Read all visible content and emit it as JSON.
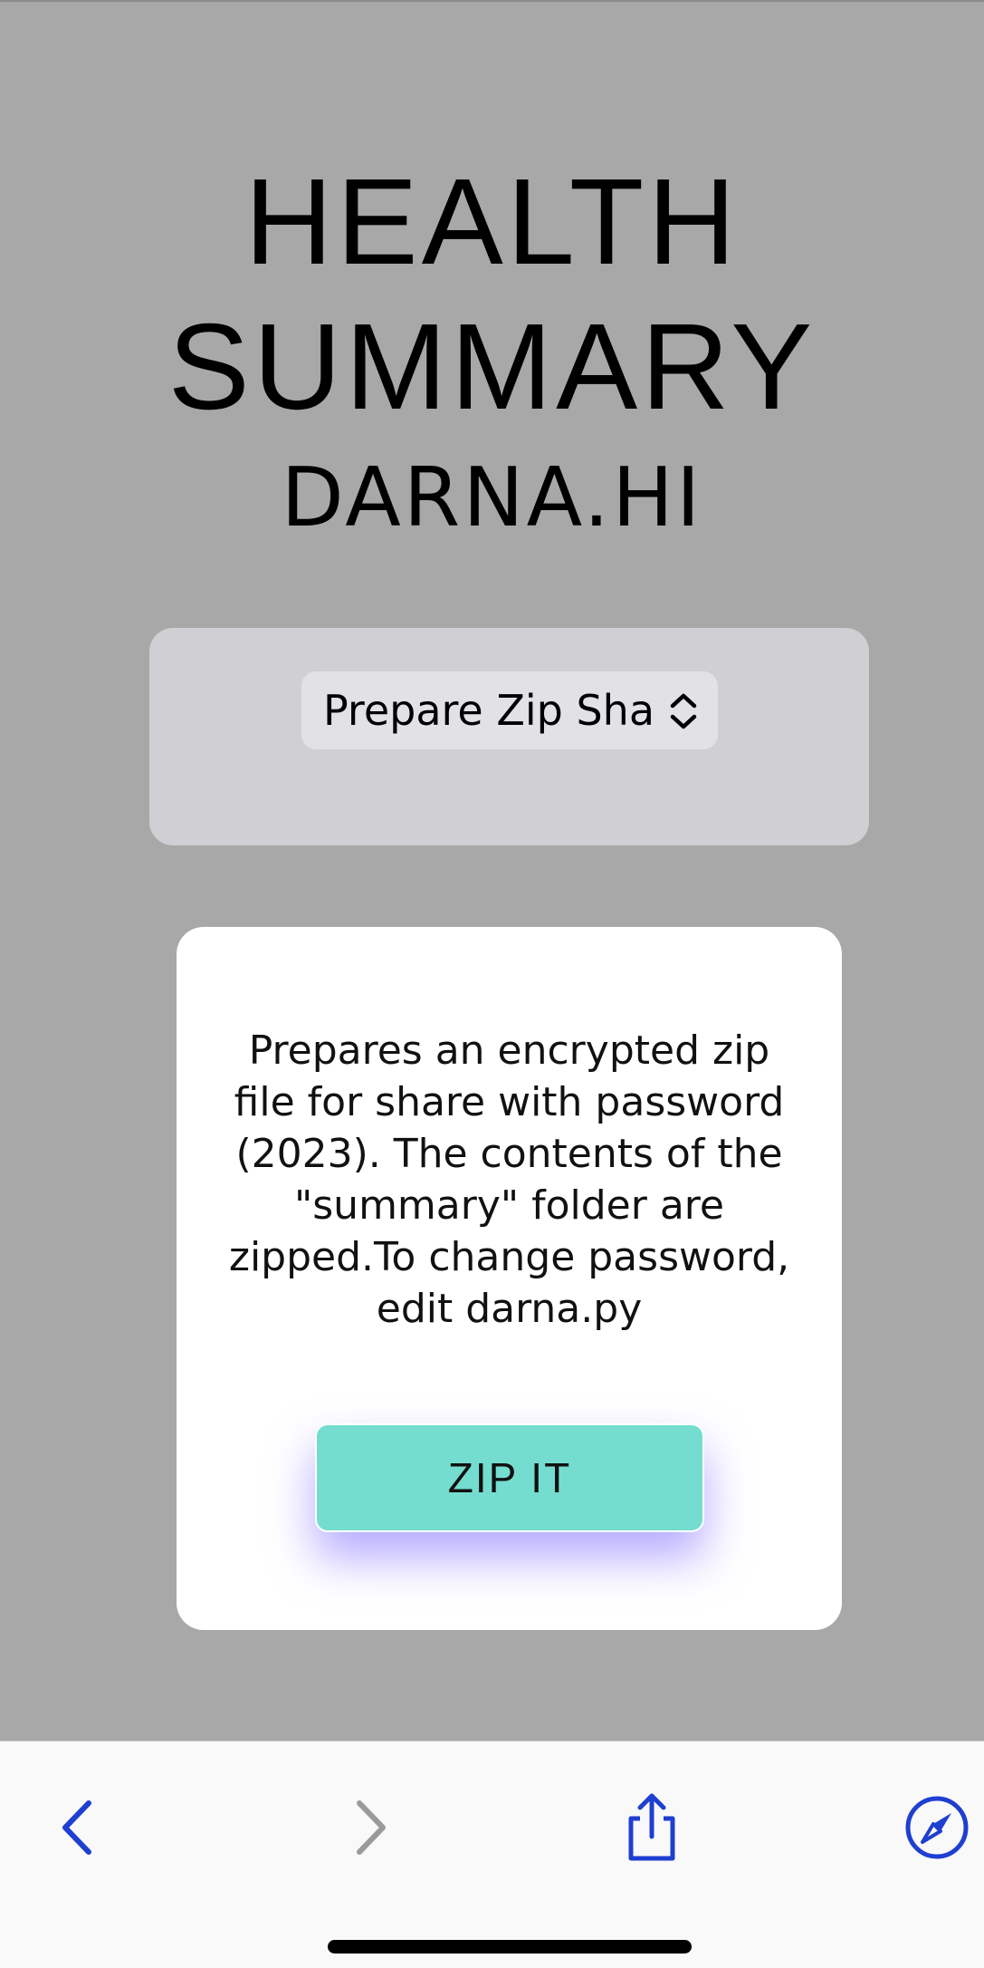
{
  "header": {
    "title_line1": "HEALTH",
    "title_line2": "SUMMARY",
    "subtitle": "DARNA.HI"
  },
  "action_select": {
    "selected": "Prepare Zip Share"
  },
  "card": {
    "description": "Prepares an encrypted zip file for share with password (2023). The contents of the \"summary\" folder are zipped.To change password, edit darna.py",
    "button_label": "ZIP IT"
  },
  "toolbar": {
    "items": [
      {
        "icon": "back-icon",
        "enabled": true
      },
      {
        "icon": "forward-icon",
        "enabled": false
      },
      {
        "icon": "share-icon",
        "enabled": true
      },
      {
        "icon": "compass-icon",
        "enabled": true
      }
    ]
  },
  "colors": {
    "background": "#a8a8a8",
    "panel": "#cfcfd4",
    "button": "#74ddcf",
    "button_glow": "#7864ff",
    "toolbar_accent": "#1f3fd1"
  }
}
